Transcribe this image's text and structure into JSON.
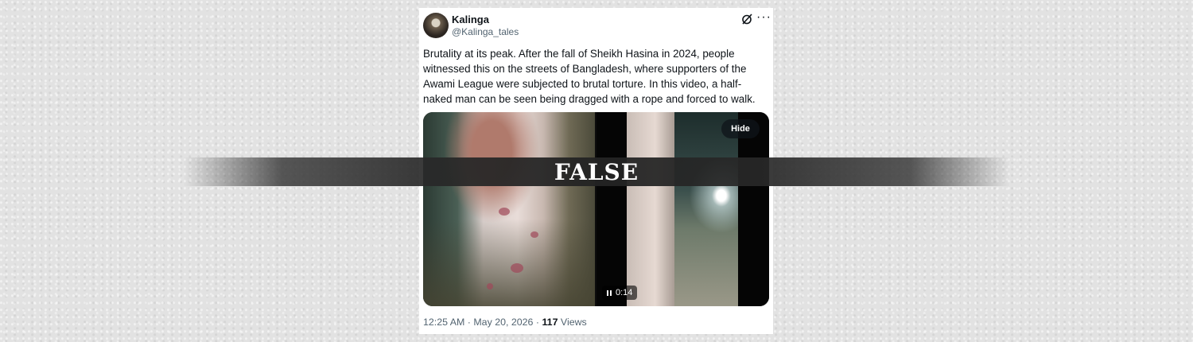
{
  "post": {
    "author_name": "Kalinga",
    "author_handle": "@Kalinga_tales",
    "text": "Brutality at its peak. After the fall of Sheikh Hasina in 2024,  people witnessed  this on the streets of Bangladesh, where supporters of the Awami League were subjected to brutal torture. In this video, a half-naked man can be seen being dragged with a rope and forced to walk.",
    "media": {
      "hide_label": "Hide",
      "duration": "0:14"
    },
    "time": "12:25 AM · May 20, 2026 · ",
    "views_count": "117",
    "views_label": " Views"
  },
  "verdict": {
    "label": "FALSE"
  },
  "icons": [
    "grok-icon",
    "more-icon",
    "pause-icon"
  ]
}
